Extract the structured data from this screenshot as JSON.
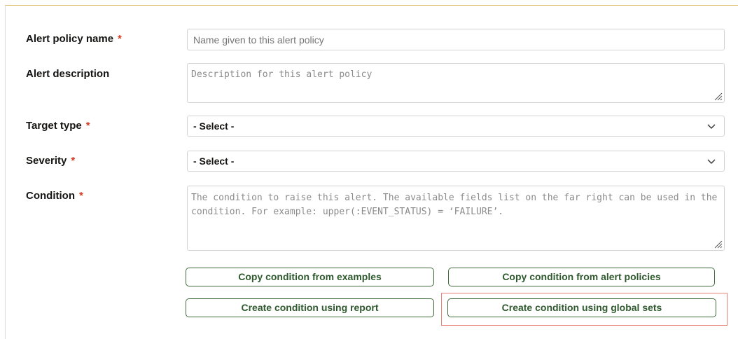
{
  "form": {
    "alert_policy_name": {
      "label": "Alert policy name",
      "required_mark": "*",
      "placeholder": "Name given to this alert policy",
      "value": ""
    },
    "alert_description": {
      "label": "Alert description",
      "placeholder": "Description for this alert policy",
      "value": ""
    },
    "target_type": {
      "label": "Target type",
      "required_mark": "*",
      "selected": "- Select -"
    },
    "severity": {
      "label": "Severity",
      "required_mark": "*",
      "selected": "- Select -"
    },
    "condition": {
      "label": "Condition",
      "required_mark": "*",
      "placeholder": "The condition to raise this alert. The available fields list on the far right can be used in the condition. For example: upper(:EVENT_STATUS) = ‘FAILURE’.",
      "value": ""
    }
  },
  "buttons": {
    "copy_from_examples": "Copy condition from examples",
    "copy_from_alert_policies": "Copy condition from alert policies",
    "create_using_report": "Create condition using report",
    "create_using_global_sets": "Create condition using global sets"
  },
  "colors": {
    "required": "#d63b25",
    "button_text": "#2e5a2d",
    "button_border": "#3f6a3c",
    "highlight": "#e8837a",
    "top_border": "#d9b55a"
  },
  "icons": {
    "select_arrow": "chevron-down-icon",
    "textarea_resize": "resize-grip-icon"
  }
}
